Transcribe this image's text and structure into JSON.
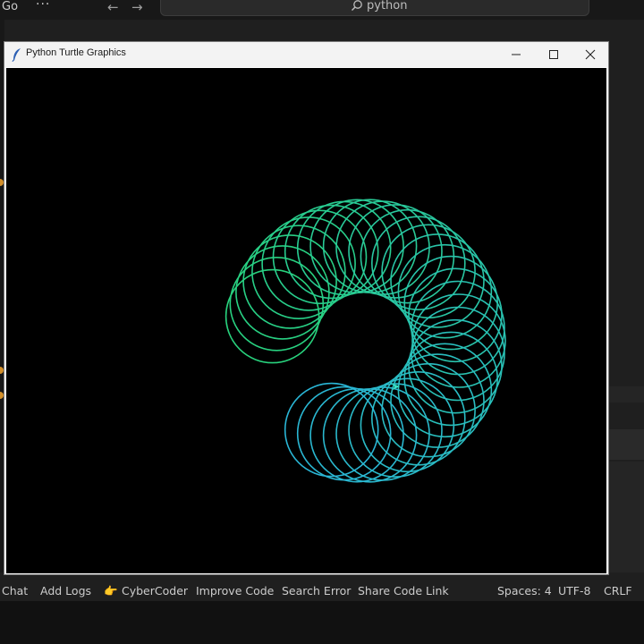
{
  "topbar": {
    "menu_go": "Go",
    "more_label": "···",
    "search_text": "python"
  },
  "turtle_window": {
    "title": "Python Turtle Graphics"
  },
  "drawing": {
    "loop_count": 36,
    "colors": {
      "start": "#28d27d",
      "end": "#2ab6d6",
      "mid": "#38e0c4",
      "background": "#000000"
    }
  },
  "statusbar": {
    "chat": "Chat",
    "add_logs": "Add Logs",
    "cybercoder_emoji": "👉",
    "cybercoder": "CyberCoder",
    "improve_code": "Improve Code",
    "search_error": "Search Error",
    "share_code_link": "Share Code Link",
    "spaces": "Spaces: 4",
    "encoding": "UTF-8",
    "eol": "CRLF"
  }
}
